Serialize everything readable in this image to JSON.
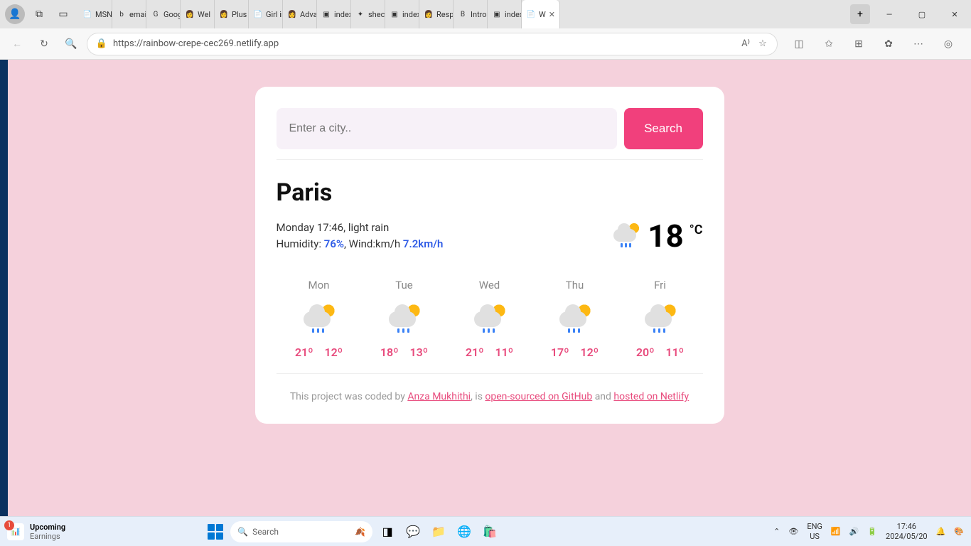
{
  "browser": {
    "url": "https://rainbow-crepe-cec269.netlify.app",
    "tabs": [
      {
        "label": "MSN S",
        "icon": "📄"
      },
      {
        "label": "email I",
        "icon": "b"
      },
      {
        "label": "Google",
        "icon": "G"
      },
      {
        "label": "Wel",
        "icon": "👩"
      },
      {
        "label": "Plus Fir",
        "icon": "👩"
      },
      {
        "label": "Girl in",
        "icon": "📄"
      },
      {
        "label": "Advan",
        "icon": "👩"
      },
      {
        "label": "index.h",
        "icon": "▣"
      },
      {
        "label": "shecod",
        "icon": "✦"
      },
      {
        "label": "index.h",
        "icon": "▣"
      },
      {
        "label": "Respor",
        "icon": "👩"
      },
      {
        "label": "Introdu",
        "icon": "B"
      },
      {
        "label": "index.h",
        "icon": "▣"
      },
      {
        "label": "W",
        "icon": "📄",
        "active": true
      }
    ]
  },
  "search": {
    "placeholder": "Enter a city..",
    "button": "Search"
  },
  "weather": {
    "city": "Paris",
    "datetime": "Monday 17:46",
    "condition": "light rain",
    "humidity_label": "Humidity: ",
    "humidity": "76%",
    "wind_label": ", Wind:km/h ",
    "wind": "7.2km/h",
    "temp": "18",
    "unit": "°C"
  },
  "forecast": [
    {
      "day": "Mon",
      "high": "21º",
      "low": "12º"
    },
    {
      "day": "Tue",
      "high": "18º",
      "low": "13º"
    },
    {
      "day": "Wed",
      "high": "21º",
      "low": "11º"
    },
    {
      "day": "Thu",
      "high": "17º",
      "low": "12º"
    },
    {
      "day": "Fri",
      "high": "20º",
      "low": "11º"
    }
  ],
  "footer": {
    "prefix": "This project was coded by ",
    "author": "Anza Mukhithi",
    "mid1": ", is ",
    "link1": "open-sourced on GitHub",
    "mid2": " and ",
    "link2": "hosted on Netlify"
  },
  "taskbar": {
    "widget_badge": "1",
    "widget_title": "Upcoming",
    "widget_sub": "Earnings",
    "search_placeholder": "Search",
    "lang1": "ENG",
    "lang2": "US",
    "time": "17:46",
    "date": "2024/05/20"
  }
}
